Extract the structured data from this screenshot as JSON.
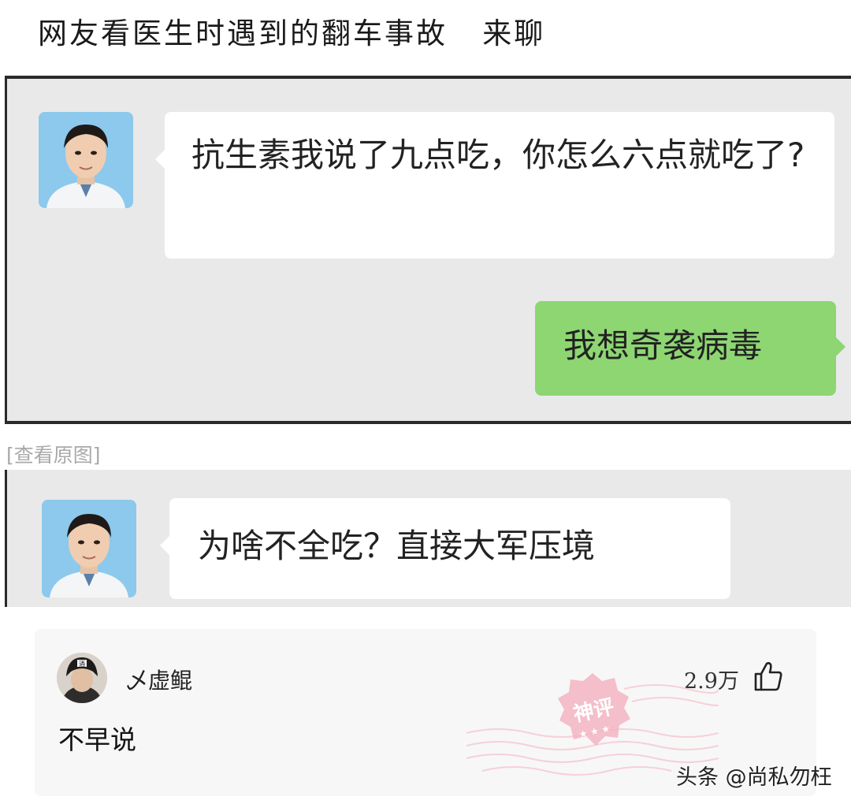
{
  "post": {
    "title": "网友看医生时遇到的翻车事故   来聊"
  },
  "screenshot1": {
    "doctor_message": "抗生素我说了九点吃，你怎么六点就吃了?",
    "patient_reply": "我想奇袭病毒"
  },
  "view_original_label": "[查看原图]",
  "screenshot2": {
    "doctor_message": "为啥不全吃？直接大军压境"
  },
  "comment": {
    "username": "乄虚鲲",
    "likes": "2.9万",
    "text": "不早说",
    "badge": "神评",
    "avatar_badge_text": "酒"
  },
  "watermark": "头条 @尚私勿枉",
  "colors": {
    "chat_bg": "#e9e9e9",
    "bubble_white": "#ffffff",
    "bubble_green": "#8dd672",
    "card_bg": "#f7f7f7",
    "badge_pink": "#f3b7c4"
  }
}
